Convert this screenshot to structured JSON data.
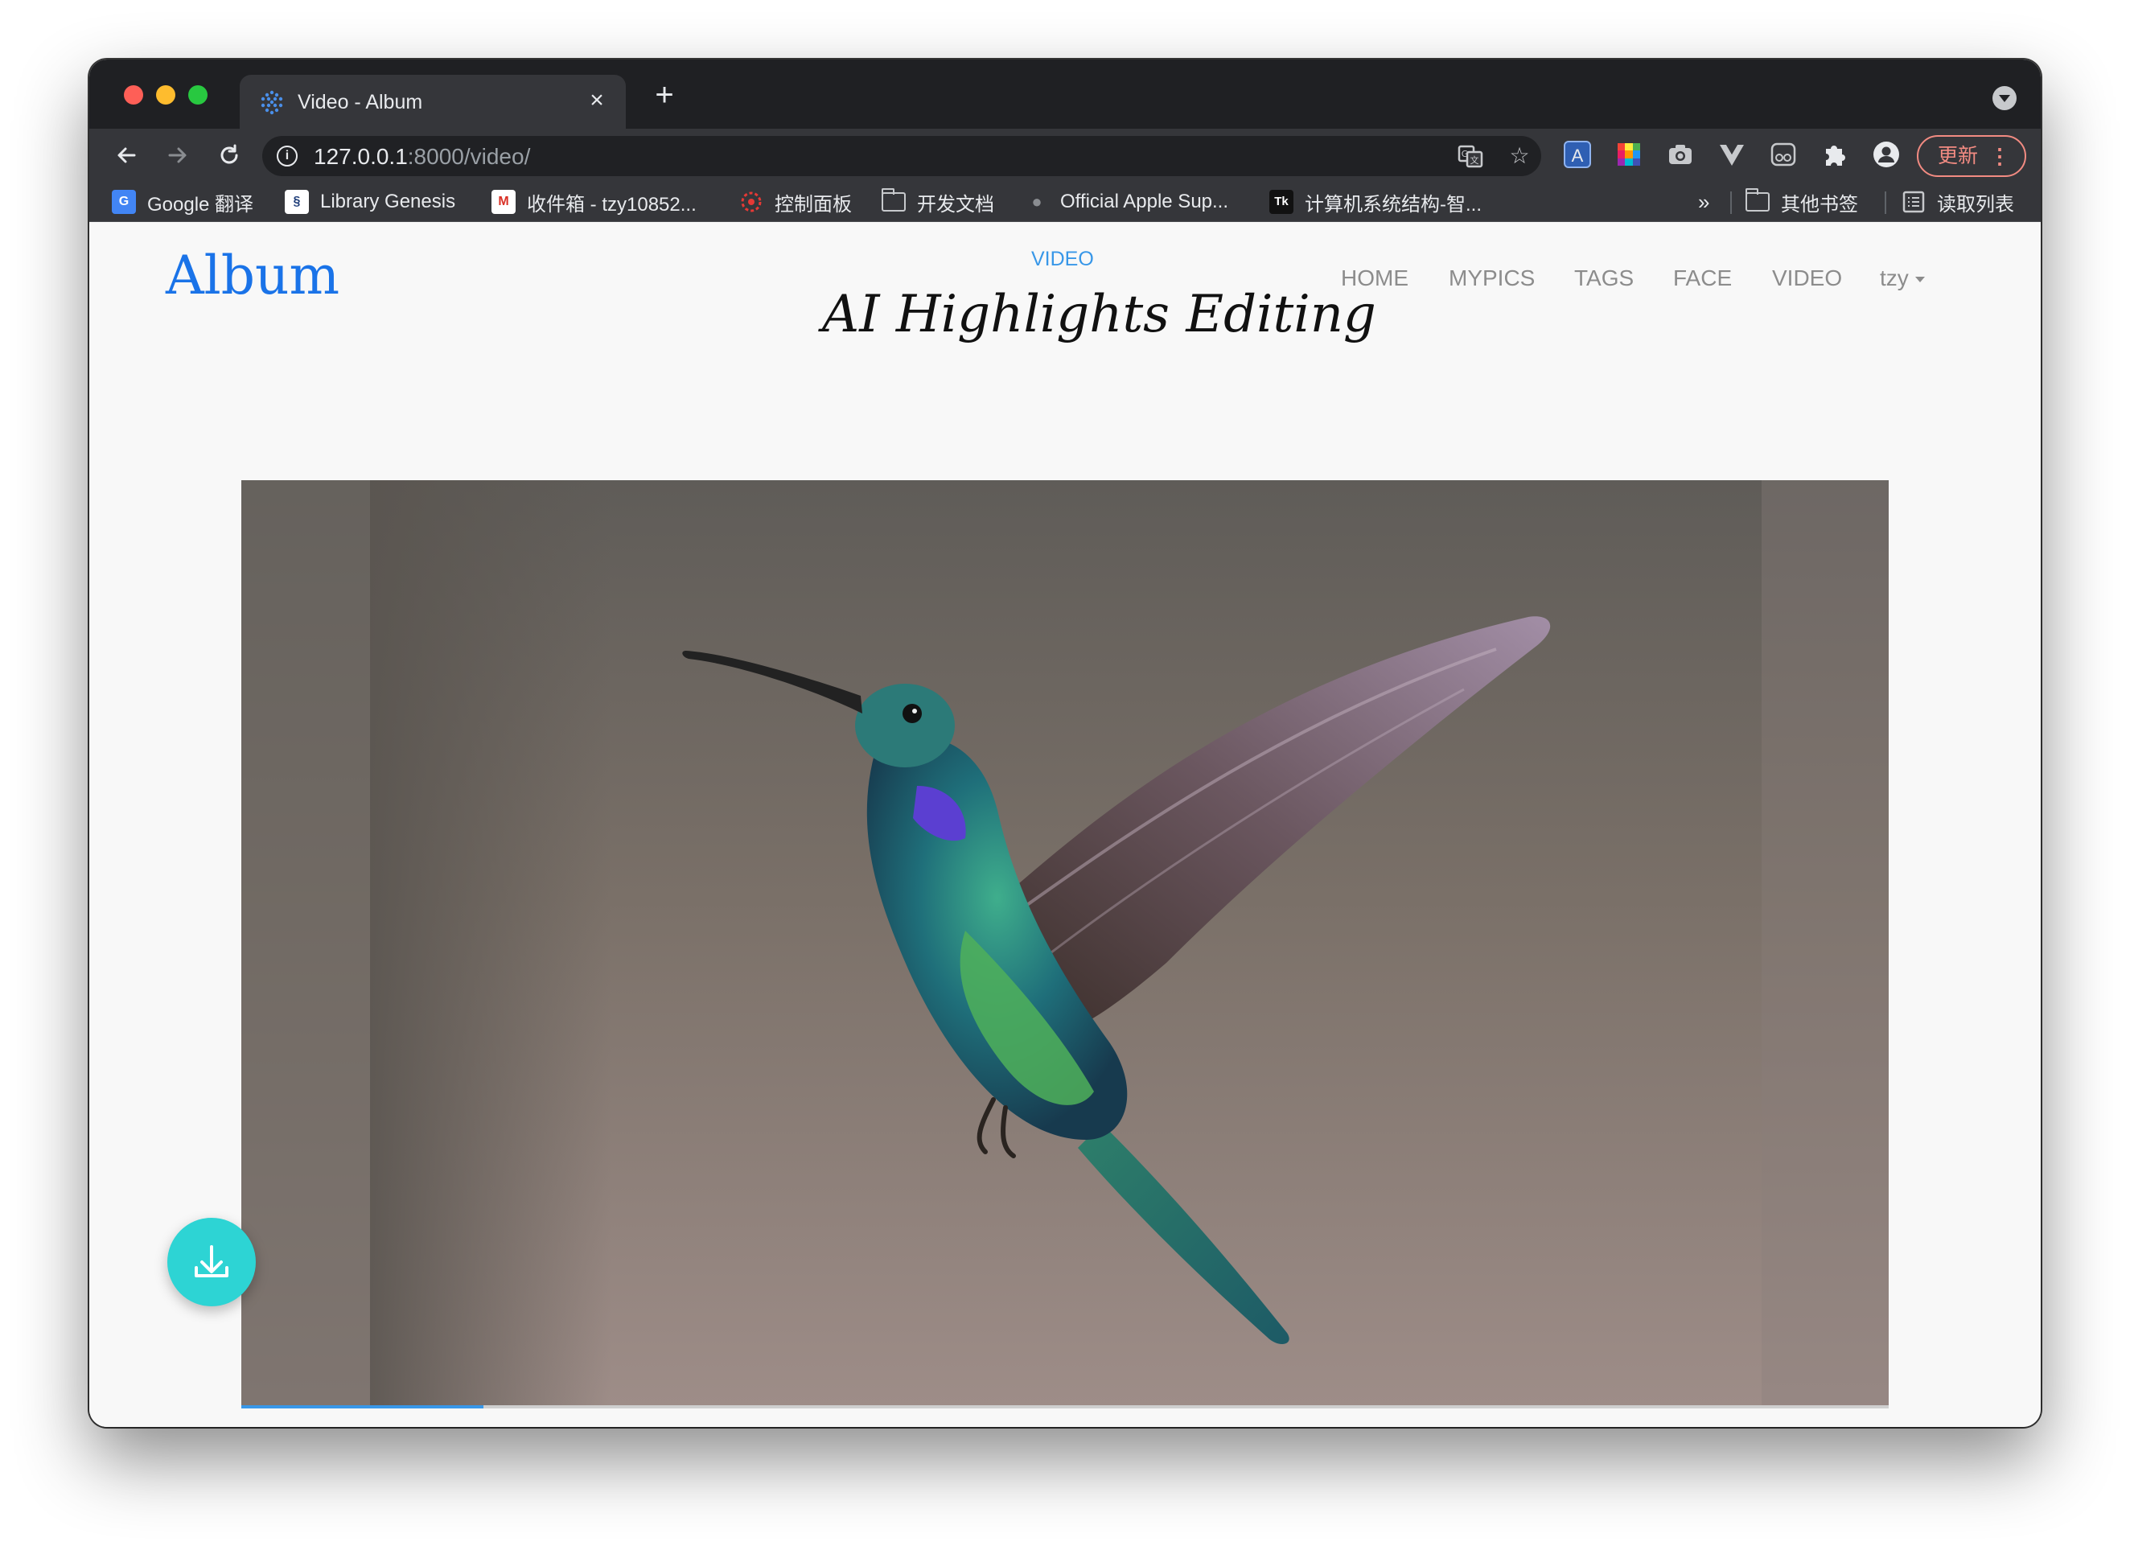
{
  "browser": {
    "tab_title": "Video - Album",
    "tab_close": "×",
    "new_tab": "+",
    "url_host": "127.0.0.1",
    "url_path": ":8000/video/",
    "update_label": "更新",
    "update_menu": "⋮"
  },
  "bookmarks": [
    {
      "label": "Google 翻译",
      "icon": "google-translate-icon"
    },
    {
      "label": "Library Genesis",
      "icon": "libgen-icon"
    },
    {
      "label": "收件箱 - tzy10852...",
      "icon": "gmail-icon"
    },
    {
      "label": "控制面板",
      "icon": "dashboard-icon"
    },
    {
      "label": "开发文档",
      "icon": "folder-icon"
    },
    {
      "label": "Official Apple Sup...",
      "icon": "apple-icon"
    },
    {
      "label": "计算机系统结构-智...",
      "icon": "tk-icon"
    }
  ],
  "bookmarks_overflow": "»",
  "bookmarks_other": "其他书签",
  "bookmarks_reading_list": "读取列表",
  "site": {
    "brand": "Album",
    "eyebrow": "VIDEO",
    "title": "AI Highlights Editing",
    "nav": [
      "HOME",
      "MYPICS",
      "TAGS",
      "FACE",
      "VIDEO"
    ],
    "user": "tzy"
  },
  "video": {
    "progress": 0.147
  },
  "colors": {
    "accent": "#3897e8",
    "brand": "#1a73e8",
    "fab": "#2dd4d4",
    "update": "#f28b82"
  }
}
